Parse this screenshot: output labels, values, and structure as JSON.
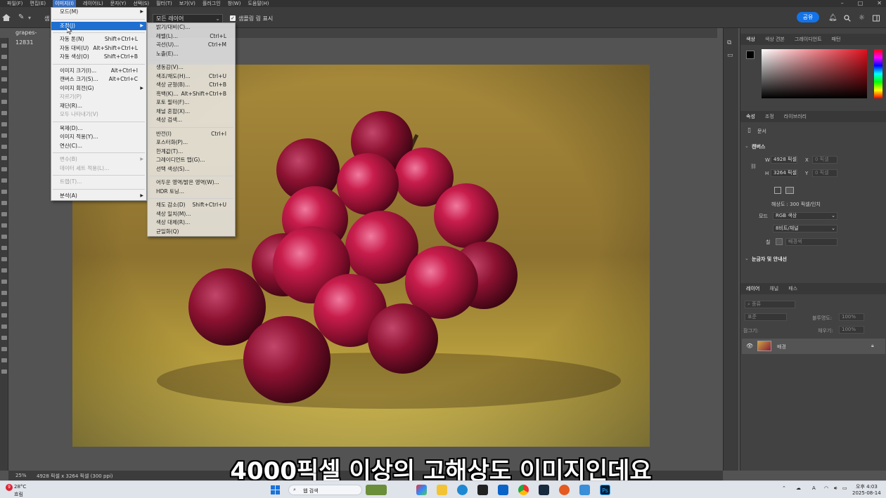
{
  "menubar": {
    "items": [
      "파일(F)",
      "편집(E)",
      "이미지(I)",
      "레이어(L)",
      "문자(Y)",
      "선택(S)",
      "필터(T)",
      "보기(V)",
      "플러그인",
      "창(W)",
      "도움말(H)"
    ]
  },
  "options_bar": {
    "sample_label": "샘",
    "layer_select": "모든 레이어",
    "sample_ring_label": "샘플링 링 표시",
    "share_label": "공유"
  },
  "document": {
    "tab_title": "grapes-12831",
    "zoom": "25%",
    "status": "4928 픽셀 x 3264 픽셀 (300 ppi)"
  },
  "image_menu": {
    "items": [
      {
        "label": "모드(M)",
        "shortcut": "",
        "submenu": true,
        "disabled": false,
        "highlight": false
      },
      {
        "sep": true
      },
      {
        "label": "조정(J)",
        "shortcut": "",
        "submenu": true,
        "disabled": false,
        "highlight": true
      },
      {
        "sep": true
      },
      {
        "label": "자동 톤(N)",
        "shortcut": "Shift+Ctrl+L",
        "submenu": false,
        "disabled": false,
        "highlight": false
      },
      {
        "label": "자동 대비(U)",
        "shortcut": "Alt+Shift+Ctrl+L",
        "submenu": false,
        "disabled": false,
        "highlight": false
      },
      {
        "label": "자동 색상(O)",
        "shortcut": "Shift+Ctrl+B",
        "submenu": false,
        "disabled": false,
        "highlight": false
      },
      {
        "sep": true
      },
      {
        "label": "이미지 크기(I)...",
        "shortcut": "Alt+Ctrl+I",
        "submenu": false,
        "disabled": false,
        "highlight": false
      },
      {
        "label": "캔버스 크기(S)...",
        "shortcut": "Alt+Ctrl+C",
        "submenu": false,
        "disabled": false,
        "highlight": false
      },
      {
        "label": "이미지 회전(G)",
        "shortcut": "",
        "submenu": true,
        "disabled": false,
        "highlight": false
      },
      {
        "label": "자르기(P)",
        "shortcut": "",
        "submenu": false,
        "disabled": true,
        "highlight": false
      },
      {
        "label": "재단(R)...",
        "shortcut": "",
        "submenu": false,
        "disabled": false,
        "highlight": false
      },
      {
        "label": "모두 나타내기(V)",
        "shortcut": "",
        "submenu": false,
        "disabled": true,
        "highlight": false
      },
      {
        "sep": true
      },
      {
        "label": "복제(D)...",
        "shortcut": "",
        "submenu": false,
        "disabled": false,
        "highlight": false
      },
      {
        "label": "이미지 적용(Y)...",
        "shortcut": "",
        "submenu": false,
        "disabled": false,
        "highlight": false
      },
      {
        "label": "연산(C)...",
        "shortcut": "",
        "submenu": false,
        "disabled": false,
        "highlight": false
      },
      {
        "sep": true
      },
      {
        "label": "변수(B)",
        "shortcut": "",
        "submenu": true,
        "disabled": true,
        "highlight": false
      },
      {
        "label": "데이터 세트 적용(L)...",
        "shortcut": "",
        "submenu": false,
        "disabled": true,
        "highlight": false
      },
      {
        "sep": true
      },
      {
        "label": "트랩(T)...",
        "shortcut": "",
        "submenu": false,
        "disabled": true,
        "highlight": false
      },
      {
        "sep": true
      },
      {
        "label": "분석(A)",
        "shortcut": "",
        "submenu": true,
        "disabled": false,
        "highlight": false
      }
    ]
  },
  "adjust_submenu": {
    "items": [
      {
        "label": "밝기/대비(C)...",
        "shortcut": ""
      },
      {
        "label": "레벨(L)...",
        "shortcut": "Ctrl+L"
      },
      {
        "label": "곡선(U)...",
        "shortcut": "Ctrl+M"
      },
      {
        "label": "노출(E)...",
        "shortcut": ""
      },
      {
        "sep": true
      },
      {
        "label": "생동감(V)...",
        "shortcut": ""
      },
      {
        "label": "색조/채도(H)...",
        "shortcut": "Ctrl+U"
      },
      {
        "label": "색상 균형(B)...",
        "shortcut": "Ctrl+B"
      },
      {
        "label": "흑백(K)...",
        "shortcut": "Alt+Shift+Ctrl+B"
      },
      {
        "label": "포토 필터(F)...",
        "shortcut": ""
      },
      {
        "label": "채널 혼합(X)...",
        "shortcut": ""
      },
      {
        "label": "색상 검색...",
        "shortcut": ""
      },
      {
        "sep": true
      },
      {
        "label": "반전(I)",
        "shortcut": "Ctrl+I"
      },
      {
        "label": "포스터화(P)...",
        "shortcut": ""
      },
      {
        "label": "한계값(T)...",
        "shortcut": ""
      },
      {
        "label": "그레이디언트 맵(G)...",
        "shortcut": ""
      },
      {
        "label": "선택 색상(S)...",
        "shortcut": ""
      },
      {
        "sep": true
      },
      {
        "label": "어두운 영역/밝은 영역(W)...",
        "shortcut": ""
      },
      {
        "label": "HDR 토닝...",
        "shortcut": ""
      },
      {
        "sep": true
      },
      {
        "label": "채도 감소(D)",
        "shortcut": "Shift+Ctrl+U"
      },
      {
        "label": "색상 일치(M)...",
        "shortcut": ""
      },
      {
        "label": "색상 대체(R)...",
        "shortcut": ""
      },
      {
        "label": "균일화(Q)",
        "shortcut": ""
      }
    ]
  },
  "color_panel": {
    "tabs": [
      "색상",
      "색상 견본",
      "그레이디언트",
      "패턴"
    ]
  },
  "properties_panel": {
    "tabs": [
      "속성",
      "조정",
      "라이브러리"
    ],
    "doc_label": "문서",
    "canvas_section": "캔버스",
    "width": "4928 픽셀",
    "height": "3264 픽셀",
    "w_label": "W",
    "h_label": "H",
    "x_label": "X",
    "y_label": "Y",
    "x_placeholder": "0 픽셀",
    "y_placeholder": "0 픽셀",
    "resolution": "해상도 : 300 픽셀/인치",
    "mode_label": "모드",
    "mode_value": "RGB 색상",
    "depth_value": "8비트/채널",
    "fill_label": "칠",
    "fill_value": "배경색",
    "rulers_section": "눈금자 및 안내선"
  },
  "layers_panel": {
    "tabs": [
      "레이어",
      "채널",
      "패스"
    ],
    "search_placeholder": "종류",
    "blend_mode": "표준",
    "opacity_label": "불투명도:",
    "opacity_value": "100%",
    "lock_label": "잠그기:",
    "fill_label": "채우기:",
    "fill_value": "100%",
    "layer_name": "배경"
  },
  "subtitle": "4000픽셀 이상의 고해상도 이미지인데요",
  "taskbar": {
    "weather_temp": "28°C",
    "weather_desc": "흐림",
    "weather_badge": "9",
    "search_label": "웹 검색",
    "time": "오후 4:03",
    "date": "2025-08-14",
    "lang": "A"
  },
  "colors": {
    "accent": "#1473e6",
    "menu_highlight": "#1e6fd0",
    "panel_bg": "#424242",
    "canvas_bg": "#535353"
  }
}
